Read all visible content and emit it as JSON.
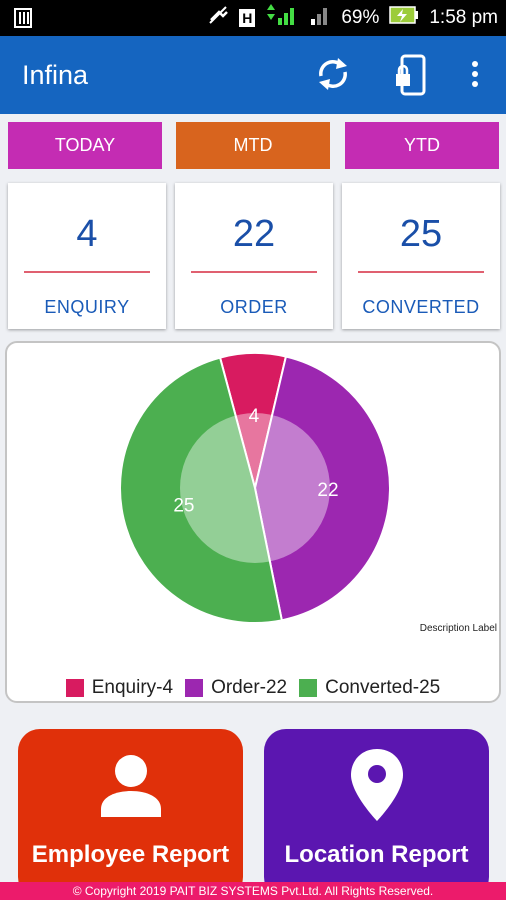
{
  "status_bar": {
    "battery": "69%",
    "time": "1:58 pm",
    "carrier_badge": "H"
  },
  "app_bar": {
    "title": "Infina",
    "icons": [
      "refresh-icon",
      "phone-lock-icon",
      "more-vert-icon"
    ]
  },
  "tabs": [
    {
      "label": "TODAY",
      "color": "#c42cb3"
    },
    {
      "label": "MTD",
      "color": "#d8641e"
    },
    {
      "label": "YTD",
      "color": "#c42cb3"
    }
  ],
  "stats": [
    {
      "value": "4",
      "label": "ENQUIRY"
    },
    {
      "value": "22",
      "label": "ORDER"
    },
    {
      "value": "25",
      "label": "CONVERTED"
    }
  ],
  "chart": {
    "description_label": "Description Label",
    "legend": [
      "Enquiry-4",
      "Order-22",
      "Converted-25"
    ]
  },
  "chart_data": {
    "type": "pie",
    "categories": [
      "Enquiry",
      "Order",
      "Converted"
    ],
    "values": [
      4,
      22,
      25
    ],
    "value_labels": [
      "4",
      "22",
      "25"
    ],
    "colors": [
      "#d81b60",
      "#9c27b0",
      "#4caf50"
    ]
  },
  "reports": [
    {
      "label": "Employee Report",
      "icon": "person-icon",
      "color": "#e0300a"
    },
    {
      "label": "Location Report",
      "icon": "location-pin-icon",
      "color": "#5b16b0"
    }
  ],
  "footer": {
    "text": "© Copyright 2019 PAIT BIZ SYSTEMS Pvt.Ltd. All Rights Reserved."
  }
}
